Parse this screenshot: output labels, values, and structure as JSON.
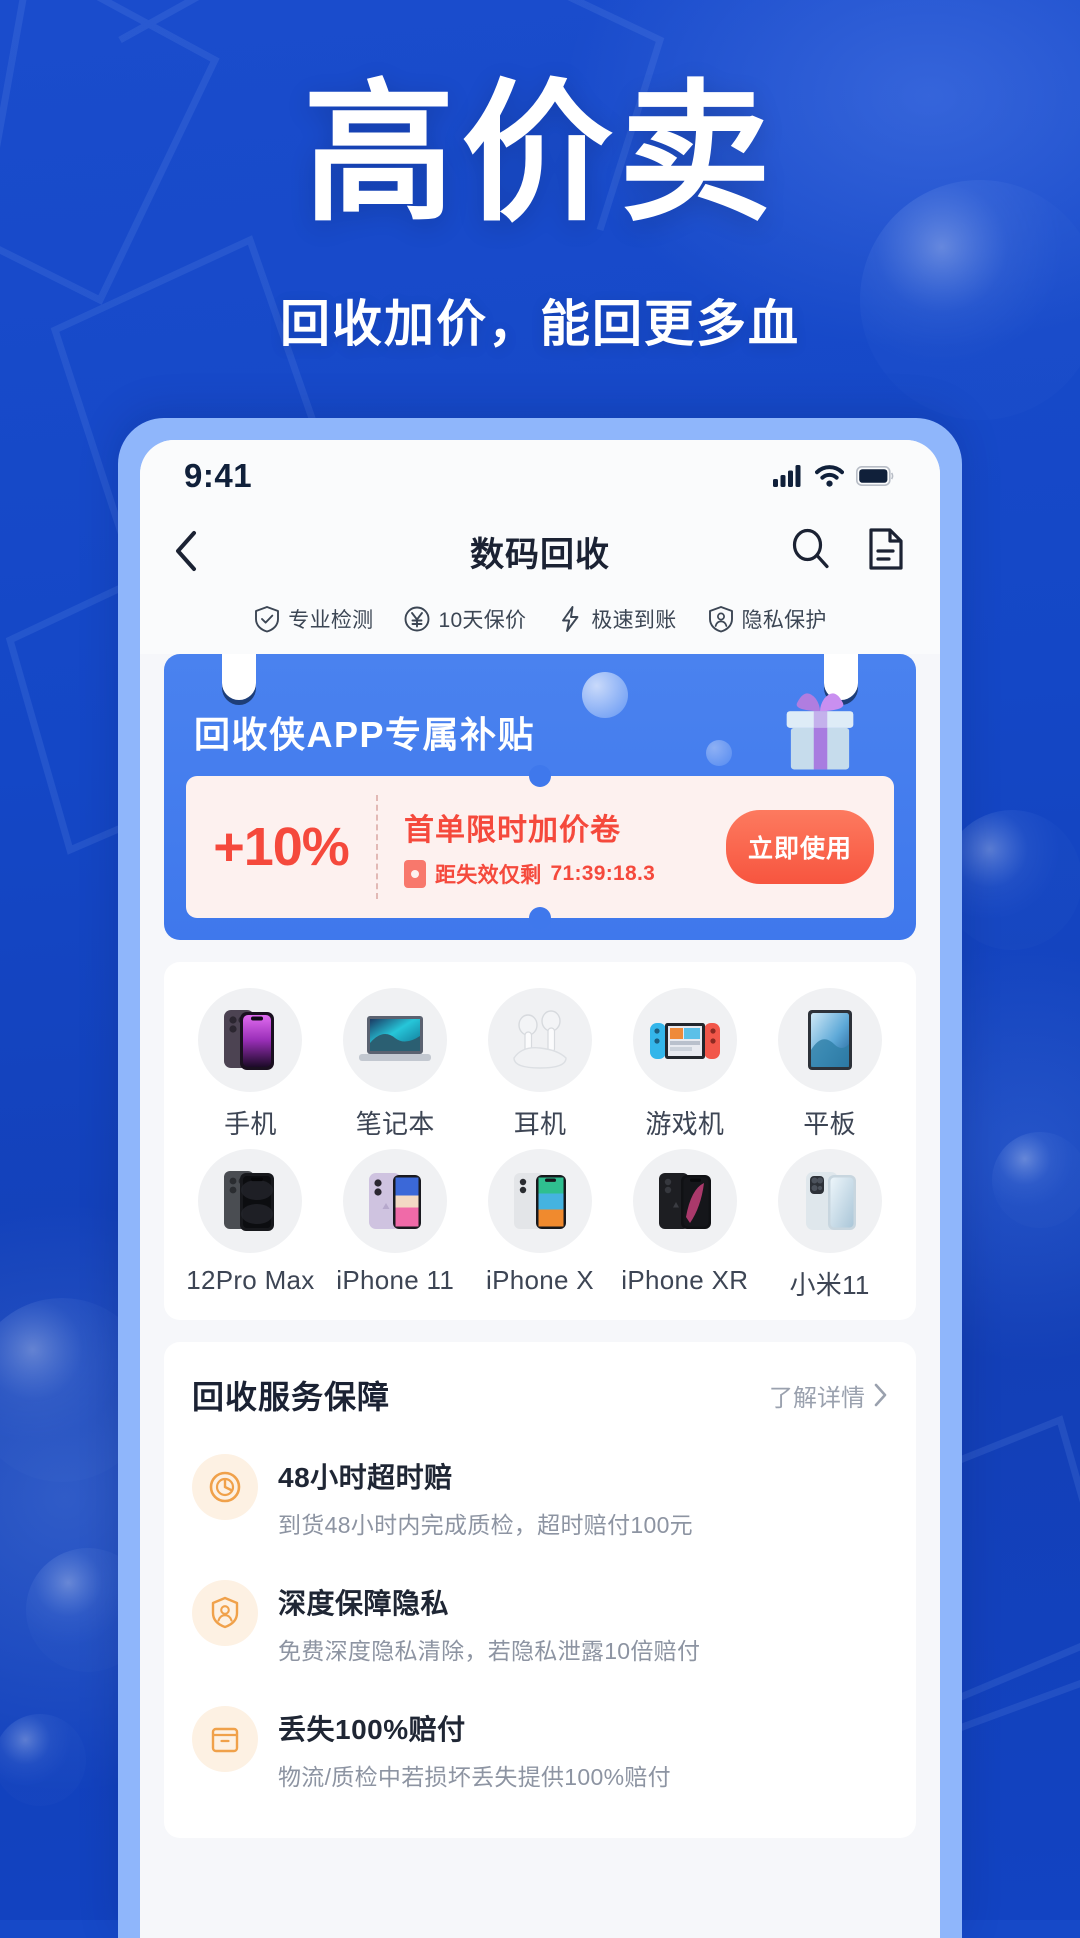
{
  "poster": {
    "title": "高价卖",
    "subtitle": "回收加价，能回更多血",
    "bg_color": "#1649c8",
    "frame_color": "#8fb6fb"
  },
  "status_bar": {
    "time": "9:41",
    "icons": [
      "cellular-signal-icon",
      "wifi-icon",
      "battery-icon"
    ]
  },
  "navbar": {
    "back_icon": "chevron-left-icon",
    "title": "数码回收",
    "actions": [
      {
        "icon": "search-icon",
        "name": "search-button"
      },
      {
        "icon": "document-icon",
        "name": "order-list-button"
      }
    ]
  },
  "features": [
    {
      "icon": "shield-check-icon",
      "label": "专业检测"
    },
    {
      "icon": "yen-circle-icon",
      "label": "10天保价"
    },
    {
      "icon": "lightning-icon",
      "label": "极速到账"
    },
    {
      "icon": "shield-person-icon",
      "label": "隐私保护"
    }
  ],
  "banner": {
    "title": "回收侠APP专属补贴",
    "gift_icon": "gift-box-icon",
    "accent_color": "#3f78ec",
    "coupon": {
      "amount": "+10%",
      "name": "首单限时加价卷",
      "timer_icon": "coupon-ticket-icon",
      "timer_label": "距失效仅剩",
      "timer_value": "71:39:18.3",
      "button_label": "立即使用",
      "text_color": "#f5493c",
      "bg_color": "#fdf1ef"
    }
  },
  "categories": [
    {
      "label": "手机",
      "icon": "iphone-14-pro-icon"
    },
    {
      "label": "笔记本",
      "icon": "laptop-icon"
    },
    {
      "label": "耳机",
      "icon": "earbuds-icon"
    },
    {
      "label": "游戏机",
      "icon": "nintendo-switch-icon"
    },
    {
      "label": "平板",
      "icon": "tablet-icon"
    },
    {
      "label": "12Pro Max",
      "icon": "iphone-12-pro-max-icon"
    },
    {
      "label": "iPhone 11",
      "icon": "iphone-11-icon"
    },
    {
      "label": "iPhone X",
      "icon": "iphone-x-icon"
    },
    {
      "label": "iPhone XR",
      "icon": "iphone-xr-icon"
    },
    {
      "label": "小米11",
      "icon": "xiaomi-11-icon"
    }
  ],
  "service": {
    "title": "回收服务保障",
    "more_label": "了解详情",
    "more_icon": "chevron-right-icon",
    "items": [
      {
        "icon": "clock-icon",
        "name": "48小时超时赔",
        "desc": "到货48小时内完成质检，超时赔付100元"
      },
      {
        "icon": "privacy-person-icon",
        "name": "深度保障隐私",
        "desc": "免费深度隐私清除，若隐私泄露10倍赔付"
      },
      {
        "icon": "package-icon",
        "name": "丢失100%赔付",
        "desc": "物流/质检中若损坏丢失提供100%赔付"
      }
    ]
  }
}
